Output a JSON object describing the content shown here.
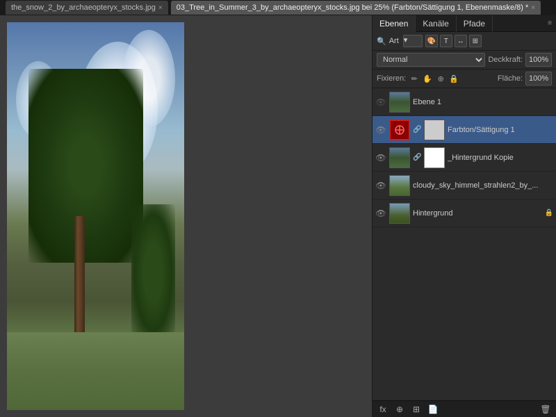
{
  "titleBar": {
    "tab1": {
      "label": "the_snow_2_by_archaeopteryx_stocks.jpg",
      "active": false,
      "closeIcon": "×"
    },
    "tab2": {
      "label": "03_Tree_in_Summer_3_by_archaeopteryx_stocks.jpg bei 25% (Farbton/Sättigung 1, Ebenenmaske/8) *",
      "active": true,
      "closeIcon": "×"
    }
  },
  "panel": {
    "tabs": [
      {
        "label": "Ebenen",
        "active": true
      },
      {
        "label": "Kanäle",
        "active": false
      },
      {
        "label": "Pfade",
        "active": false
      }
    ],
    "panelMenuIcon": "≡",
    "filterBar": {
      "searchIcon": "🔍",
      "placeholder": "Art",
      "dropdownArrow": "▾",
      "iconButtons": [
        "🎨",
        "T",
        "↔",
        "⊞"
      ]
    },
    "blendMode": {
      "value": "Normal",
      "opacityLabel": "Deckkraft:",
      "opacityValue": "100%"
    },
    "fixRow": {
      "label": "Fixieren:",
      "icons": [
        "✏",
        "✋",
        "⊕",
        "🔒"
      ],
      "fillLabel": "Fläche:",
      "fillValue": "100%"
    },
    "layers": [
      {
        "id": "ebene1",
        "name": "Ebene 1",
        "visible": false,
        "type": "normal",
        "hasThumb": true,
        "hasMask": false,
        "selected": false,
        "locked": false
      },
      {
        "id": "farbton",
        "name": "Farbton/Sättigung 1",
        "visible": true,
        "type": "adjustment",
        "hasThumb": true,
        "hasMask": true,
        "selected": true,
        "locked": false
      },
      {
        "id": "hintergrund-kopie",
        "name": "_Hintergrund Kopie",
        "visible": true,
        "type": "normal",
        "hasThumb": true,
        "hasMask": true,
        "selected": false,
        "locked": false
      },
      {
        "id": "cloudy-sky",
        "name": "cloudy_sky_himmel_strahlen2_by_...",
        "visible": true,
        "type": "normal",
        "hasThumb": true,
        "hasMask": false,
        "selected": false,
        "locked": false
      },
      {
        "id": "hintergrund",
        "name": "Hintergrund",
        "visible": true,
        "type": "normal",
        "hasThumb": true,
        "hasMask": false,
        "selected": false,
        "locked": true
      }
    ],
    "bottomButtons": [
      "fx",
      "⊕",
      "⊞",
      "🗑"
    ]
  }
}
